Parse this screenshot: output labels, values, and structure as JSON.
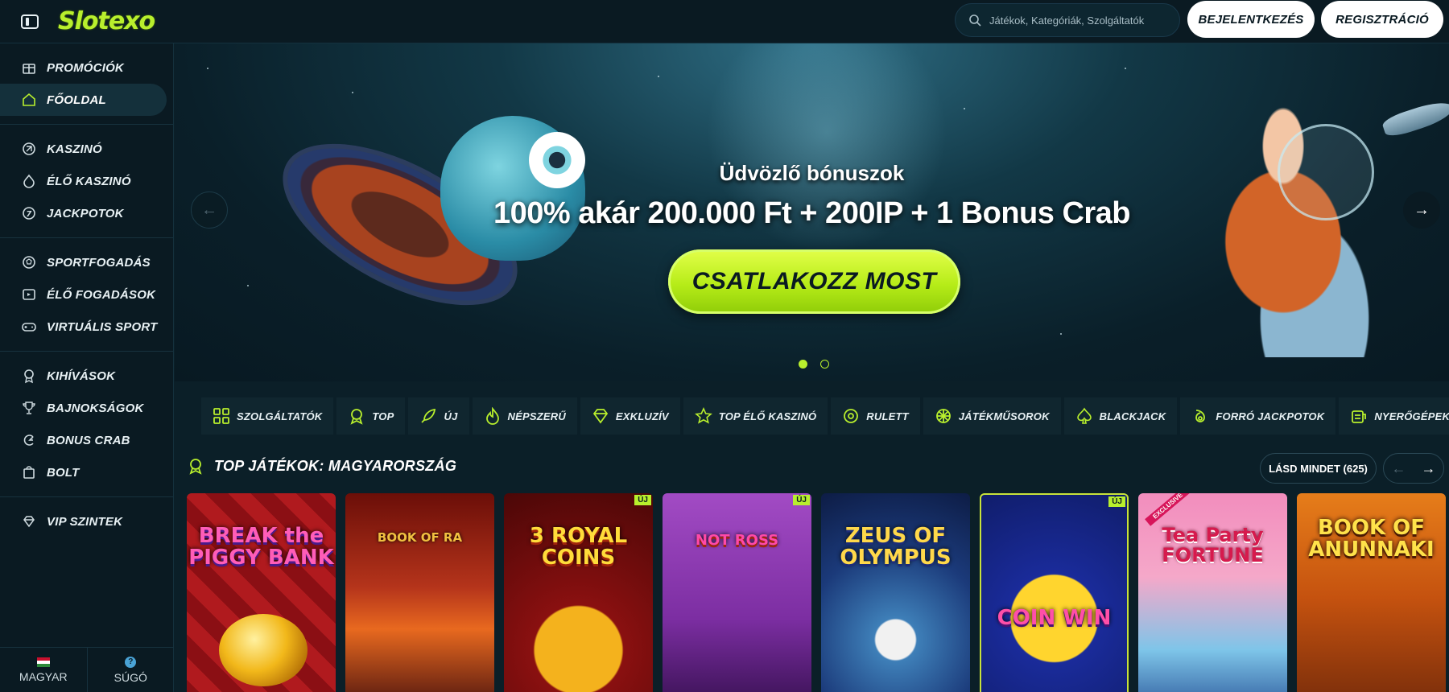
{
  "header": {
    "logo_text": "Slotexo",
    "search_placeholder": "Játékok, Kategóriák, Szolgáltatók",
    "login_label": "BEJELENTKEZÉS",
    "register_label": "REGISZTRÁCIÓ"
  },
  "sidebar": {
    "items": [
      {
        "label": "PROMÓCIÓK",
        "icon": "promotions-icon"
      },
      {
        "label": "FŐOLDAL",
        "icon": "home-icon",
        "active": true
      },
      {
        "label": "KASZINÓ",
        "icon": "casino-icon"
      },
      {
        "label": "ÉLŐ KASZINÓ",
        "icon": "live-casino-icon"
      },
      {
        "label": "JACKPOTOK",
        "icon": "jackpot-icon"
      },
      {
        "label": "SPORTFOGADÁS",
        "icon": "soccer-ball-icon"
      },
      {
        "label": "ÉLŐ FOGADÁSOK",
        "icon": "live-betting-icon"
      },
      {
        "label": "VIRTUÁLIS SPORT",
        "icon": "gamepad-icon"
      },
      {
        "label": "KIHÍVÁSOK",
        "icon": "medal-icon"
      },
      {
        "label": "BAJNOKSÁGOK",
        "icon": "trophy-icon"
      },
      {
        "label": "BONUS CRAB",
        "icon": "crab-claw-icon"
      },
      {
        "label": "BOLT",
        "icon": "shop-bag-icon"
      },
      {
        "label": "VIP SZINTEK",
        "icon": "diamond-icon"
      }
    ],
    "footer": {
      "language_label": "MAGYAR",
      "help_label": "SÚGÓ"
    }
  },
  "banner": {
    "subtitle": "Üdvözlő bónuszok",
    "title": "100% akár 200.000 Ft + 200IP + 1 Bonus Crab",
    "cta_label": "CSATLAKOZZ MOST",
    "slide_count": 2,
    "active_slide": 1
  },
  "categories": [
    {
      "label": "SZOLGÁLTATÓK",
      "icon": "grid-icon"
    },
    {
      "label": "TOP",
      "icon": "award-icon"
    },
    {
      "label": "ÚJ",
      "icon": "rocket-icon"
    },
    {
      "label": "NÉPSZERŰ",
      "icon": "flame-icon"
    },
    {
      "label": "EXKLUZÍV",
      "icon": "diamond-icon"
    },
    {
      "label": "TOP ÉLŐ KASZINÓ",
      "icon": "star-icon"
    },
    {
      "label": "RULETT",
      "icon": "roulette-icon"
    },
    {
      "label": "JÁTÉKMŰSOROK",
      "icon": "wheel-icon"
    },
    {
      "label": "BLACKJACK",
      "icon": "spade-icon"
    },
    {
      "label": "FORRÓ JACKPOTOK",
      "icon": "hot-jackpot-icon"
    },
    {
      "label": "NYERŐGÉPEK",
      "icon": "slot-machine-icon"
    }
  ],
  "top_games": {
    "title": "TOP JÁTÉKOK: MAGYARORSZÁG",
    "see_all_label": "LÁSD MINDET (625)",
    "games": [
      {
        "title": "BREAK the PIGGY BANK",
        "new": false
      },
      {
        "title": "BOOK OF RA",
        "new": false
      },
      {
        "title": "3 ROYAL COINS",
        "new": true
      },
      {
        "title": "NOT ROSS",
        "new": true
      },
      {
        "title": "ZEUS OF OLYMPUS",
        "new": false
      },
      {
        "title": "COIN WIN",
        "new": true
      },
      {
        "title": "Tea Party FORTUNE",
        "new": false
      },
      {
        "title": "BOOK OF ANUNNAKI",
        "new": false
      }
    ],
    "new_badge_label": "ÚJ",
    "exclusive_label": "EXCLUSIVE"
  },
  "colors": {
    "accent": "#b8ef2d",
    "background": "#0b1f28",
    "panel": "#0a1a22"
  }
}
